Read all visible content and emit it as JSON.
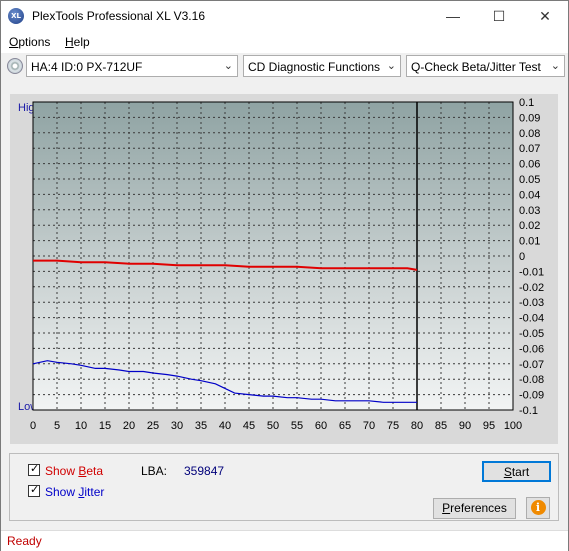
{
  "window": {
    "title": "PlexTools Professional XL V3.16",
    "app_icon_text": "XL",
    "minimize_icon": "minimize-icon",
    "maximize_icon": "maximize-icon",
    "close_icon": "close-icon"
  },
  "menu": {
    "items": [
      {
        "label": "Options",
        "accel": "O",
        "rest": "ptions"
      },
      {
        "label": "Help",
        "accel": "H",
        "rest": "elp"
      }
    ]
  },
  "toolbar": {
    "drive": "HA:4 ID:0  PX-712UF",
    "function": "CD Diagnostic Functions",
    "test": "Q-Check Beta/Jitter Test"
  },
  "chart_data": {
    "type": "line",
    "y_left_labels": {
      "top": "High",
      "bottom": "Low"
    },
    "x_ticks": [
      0,
      5,
      10,
      15,
      20,
      25,
      30,
      35,
      40,
      45,
      50,
      55,
      60,
      65,
      70,
      75,
      80,
      85,
      90,
      95,
      100
    ],
    "x_range": [
      0,
      100
    ],
    "y_ticks": [
      "0.1",
      "0.09",
      "0.08",
      "0.07",
      "0.06",
      "0.05",
      "0.04",
      "0.03",
      "0.02",
      "0.01",
      "0",
      "-0.01",
      "-0.02",
      "-0.03",
      "-0.04",
      "-0.05",
      "-0.06",
      "-0.07",
      "-0.08",
      "-0.09",
      "-0.1"
    ],
    "y_range": [
      -0.1,
      0.1
    ],
    "grid": true,
    "data_end_x": 80,
    "series": [
      {
        "name": "Beta",
        "color": "#e00000",
        "x": [
          0,
          5,
          10,
          15,
          20,
          25,
          30,
          35,
          40,
          45,
          50,
          55,
          60,
          65,
          70,
          75,
          78,
          80
        ],
        "y": [
          -0.003,
          -0.003,
          -0.004,
          -0.004,
          -0.005,
          -0.005,
          -0.006,
          -0.006,
          -0.006,
          -0.007,
          -0.007,
          -0.007,
          -0.008,
          -0.008,
          -0.008,
          -0.008,
          -0.008,
          -0.009
        ]
      },
      {
        "name": "Jitter",
        "color": "#0000c8",
        "x": [
          0,
          3,
          5,
          8,
          10,
          13,
          15,
          18,
          20,
          23,
          25,
          28,
          30,
          33,
          35,
          38,
          40,
          42,
          45,
          48,
          50,
          53,
          55,
          58,
          60,
          63,
          65,
          68,
          70,
          73,
          75,
          78,
          80
        ],
        "y": [
          -0.07,
          -0.068,
          -0.069,
          -0.07,
          -0.071,
          -0.073,
          -0.073,
          -0.074,
          -0.075,
          -0.075,
          -0.076,
          -0.077,
          -0.078,
          -0.08,
          -0.081,
          -0.083,
          -0.086,
          -0.089,
          -0.09,
          -0.091,
          -0.091,
          -0.092,
          -0.092,
          -0.093,
          -0.093,
          -0.094,
          -0.094,
          -0.094,
          -0.094,
          -0.095,
          -0.095,
          -0.095,
          -0.095
        ]
      }
    ]
  },
  "controls": {
    "show_beta_label": "Show Beta",
    "show_beta_prefix": "Show ",
    "show_beta_accel": "B",
    "show_beta_rest": "eta",
    "show_beta_checked": true,
    "show_beta_color": "#d00000",
    "show_jitter_label": "Show Jitter",
    "show_jitter_prefix": "Show ",
    "show_jitter_accel": "J",
    "show_jitter_rest": "itter",
    "show_jitter_checked": true,
    "show_jitter_color": "#0000c8",
    "lba_label": "LBA:",
    "lba_value": "359847",
    "start_accel": "S",
    "start_rest": "tart",
    "preferences_accel": "P",
    "preferences_rest": "references",
    "info_icon": "info-icon"
  },
  "status": {
    "text": "Ready",
    "color": "#c00000"
  }
}
